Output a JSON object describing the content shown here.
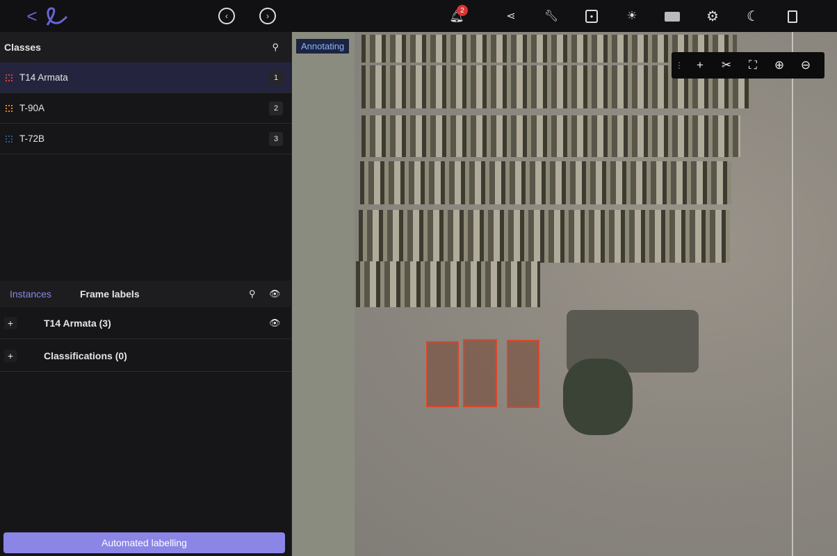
{
  "topbar": {
    "back": "<",
    "notification_count": "2",
    "icons": [
      "bell-icon",
      "share-icon",
      "wrench-icon",
      "save-icon",
      "brightness-icon",
      "keyboard-icon",
      "settings-icon",
      "moon-icon",
      "document-icon"
    ]
  },
  "classes": {
    "title": "Classes",
    "items": [
      {
        "label": "T14 Armata",
        "num": "1",
        "color": "#d9472b"
      },
      {
        "label": "T-90A",
        "num": "2",
        "color": "#e08a2b"
      },
      {
        "label": "T-72B",
        "num": "3",
        "color": "#2b5a9a"
      }
    ]
  },
  "instances": {
    "tab_instances": "Instances",
    "tab_frame": "Frame labels",
    "rows": [
      {
        "label": "T14 Armata (3)"
      },
      {
        "label": "Classifications (0)"
      }
    ]
  },
  "auto_button": "Automated labelling",
  "canvas": {
    "status": "Annotating"
  }
}
